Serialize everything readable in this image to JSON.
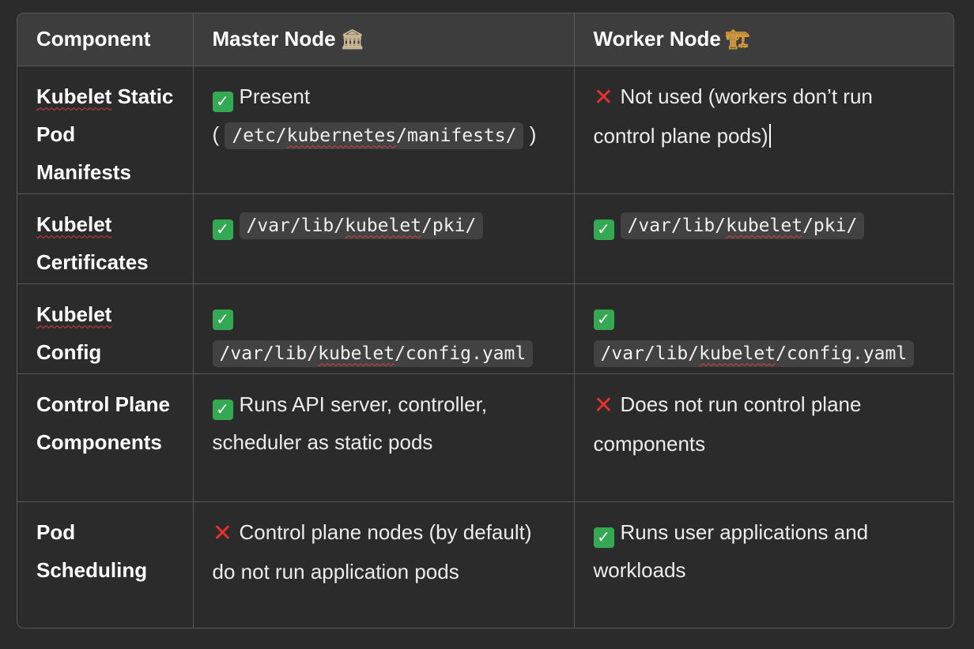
{
  "headers": {
    "component": "Component",
    "master": "Master Node",
    "worker": "Worker Node"
  },
  "icons": {
    "master_header": "classical-building-icon",
    "worker_header": "construction-crane-icon",
    "check": "check-mark-button-icon",
    "cross": "cross-mark-icon"
  },
  "colors": {
    "check_bg": "#34a853",
    "cross": "#e5322d",
    "spellcheck": "#d24040"
  },
  "rows": [
    {
      "component_a": "Kubelet",
      "component_b": "Static Pod Manifests",
      "master_text": "Present",
      "master_paren_open": "(",
      "master_code_a": "/etc/",
      "master_code_b": "kubernetes",
      "master_code_c": "/manifests/",
      "master_paren_close": ")",
      "worker_text": "Not used (workers don’t run control plane pods)"
    },
    {
      "component_a": "Kubelet",
      "component_b": "Certificates",
      "master_code_a": "/var/lib/",
      "master_code_b": "kubelet",
      "master_code_c": "/pki/",
      "worker_code_a": "/var/lib/",
      "worker_code_b": "kubelet",
      "worker_code_c": "/pki/"
    },
    {
      "component_a": "Kubelet",
      "component_b": "Config",
      "master_code_a": "/var/lib/",
      "master_code_b": "kubelet",
      "master_code_c": "/config.yaml",
      "worker_code_a": "/var/lib/",
      "worker_code_b": "kubelet",
      "worker_code_c": "/config.yaml"
    },
    {
      "component": "Control Plane Components",
      "master_text": "Runs API server, controller, scheduler as static pods",
      "worker_text": "Does not run control plane components"
    },
    {
      "component": "Pod Scheduling",
      "master_text": "Control plane nodes (by default) do not run application pods",
      "worker_text": "Runs user applications and workloads"
    }
  ]
}
